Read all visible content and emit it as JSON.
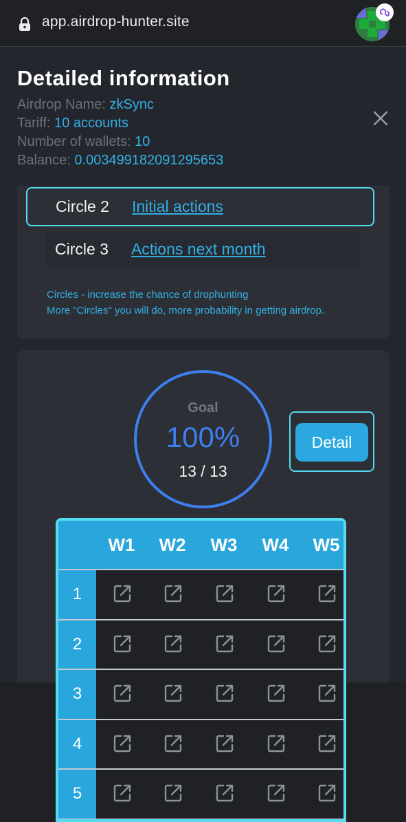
{
  "browser": {
    "url": "app.airdrop-hunter.site"
  },
  "header": {
    "title": "Detailed information",
    "airdrop_label": "Airdrop Name: ",
    "airdrop_value": "zkSync",
    "tariff_label": "Tariff: ",
    "tariff_value": "10 accounts",
    "wallets_label": "Number of wallets: ",
    "wallets_value": "10",
    "balance_label": "Balance: ",
    "balance_value": "0.003499182091295653"
  },
  "circles": {
    "rows": [
      {
        "label": "Circle 2",
        "link": "Initial actions"
      },
      {
        "label": "Circle 3",
        "link": "Actions next month"
      }
    ],
    "hint_1": "Circles - increase the chance of drophunting",
    "hint_2": "More \"Circles\" you will do, more probability in getting airdrop."
  },
  "goal": {
    "label": "Goal",
    "percent": "100%",
    "count": "13 / 13",
    "detail_button": "Detail"
  },
  "table": {
    "columns": [
      "W1",
      "W2",
      "W3",
      "W4",
      "W5"
    ],
    "rows": [
      "1",
      "2",
      "3",
      "4",
      "5"
    ],
    "cell_icon": "open-external-icon"
  },
  "colors": {
    "accent": "#33b0e4",
    "highlight_border": "#55dbee",
    "progress": "#3e7fee",
    "table_header": "#29a6dc"
  }
}
